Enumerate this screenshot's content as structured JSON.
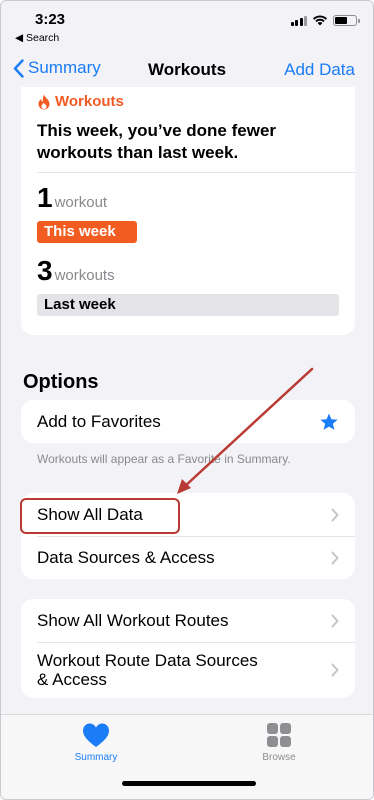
{
  "status_bar": {
    "time": "3:23",
    "back_app": "◀ Search"
  },
  "nav": {
    "back_label": "Summary",
    "title": "Workouts",
    "action_label": "Add Data"
  },
  "workouts_card": {
    "header": "Workouts",
    "message": "This week, you’ve done fewer workouts than last week.",
    "this_week": {
      "count": "1",
      "unit": "workout",
      "label": "This week"
    },
    "last_week": {
      "count": "3",
      "unit": "workouts",
      "label": "Last week"
    }
  },
  "options": {
    "title": "Options",
    "favorites": {
      "label": "Add to Favorites",
      "footnote": "Workouts will appear as a Favorite in Summary."
    },
    "data_rows": [
      "Show All Data",
      "Data Sources & Access"
    ],
    "route_rows": [
      "Show All Workout Routes",
      "Workout Route Data Sources\n& Access"
    ]
  },
  "tab_bar": {
    "summary_label": "Summary",
    "browse_label": "Browse"
  },
  "colors": {
    "accent": "#1a7cf6",
    "workout_orange": "#f25c21",
    "annotation_red": "#b93a34"
  }
}
